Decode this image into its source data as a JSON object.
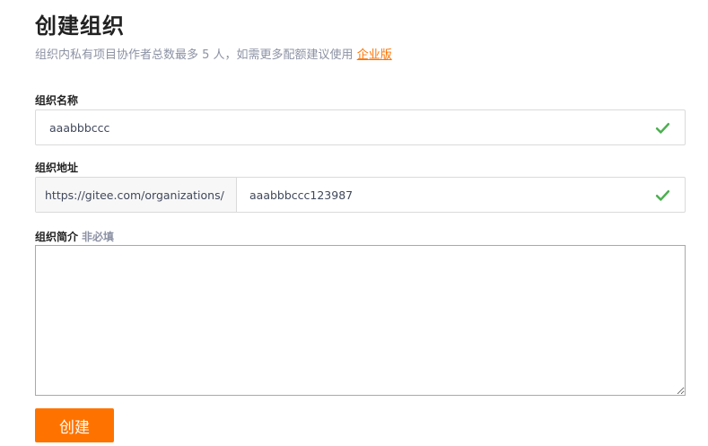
{
  "header": {
    "title": "创建组织",
    "subtitle": "组织内私有项目协作者总数最多 5 人，如需更多配额建议使用",
    "enterprise_link": "企业版"
  },
  "form": {
    "name": {
      "label": "组织名称",
      "value": "aaabbbccc",
      "valid_icon": "check-icon"
    },
    "address": {
      "label": "组织地址",
      "prefix": "https://gitee.com/organizations/",
      "value": "aaabbbccc123987",
      "valid_icon": "check-icon"
    },
    "description": {
      "label": "组织简介",
      "optional_tag": "非必填",
      "value": ""
    },
    "submit_label": "创建"
  },
  "colors": {
    "accent": "#fe7300",
    "valid": "#4caf50",
    "muted": "#8c92a4"
  }
}
